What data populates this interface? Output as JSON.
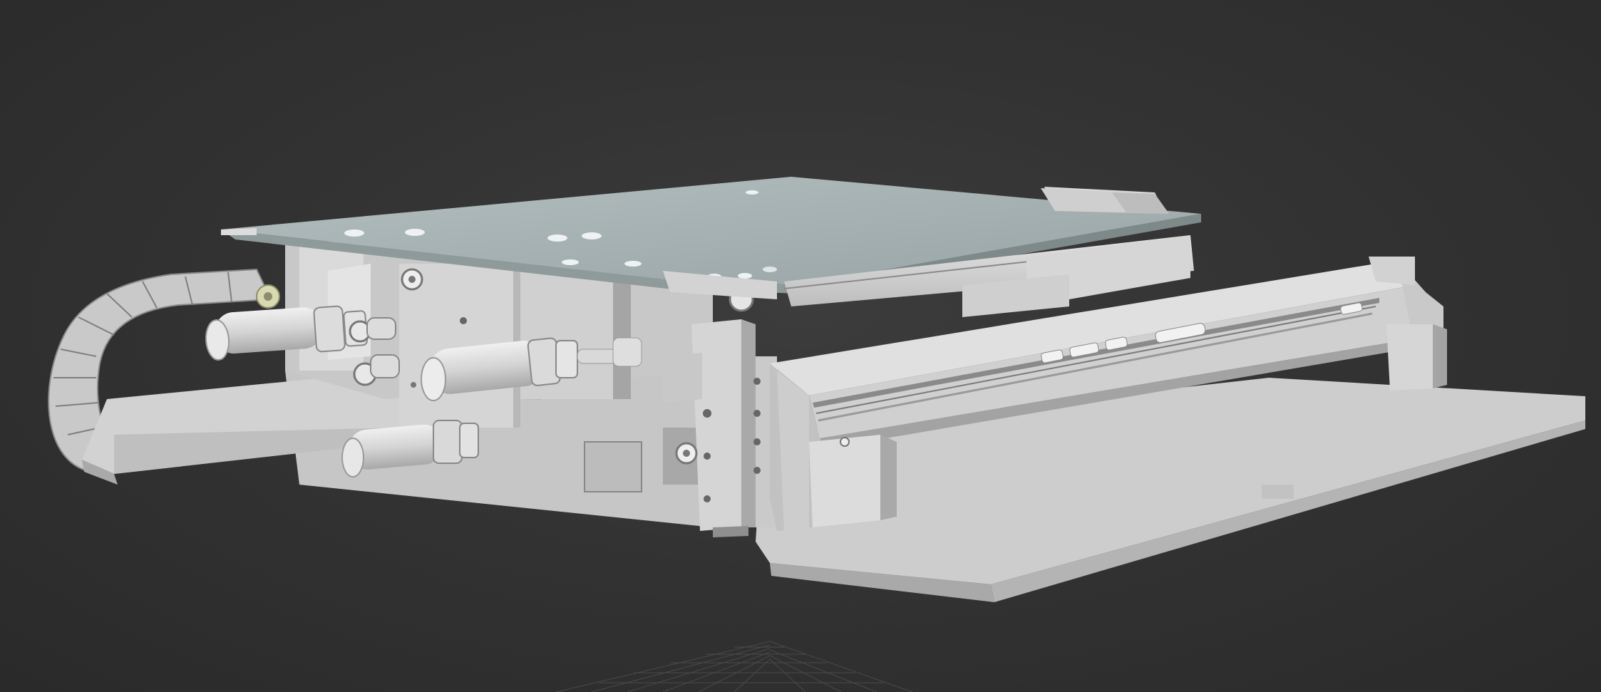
{
  "viewport": {
    "kind": "3d-viewport",
    "shading": "default-shading",
    "background_color": "#333333",
    "grid_color": "#4a4a4a"
  },
  "model": {
    "subject": "linear-stage-assembly",
    "colors": {
      "base_plate": "#cfcfcf",
      "top_plate": "#a7b3b4",
      "parts": "#d8d8d8",
      "shadow": "#9a9a9a",
      "accent_bracket": "#d7d9b0"
    },
    "parts": [
      "base-plate",
      "top-carriage-plate",
      "ball-screw-actuator",
      "cable-drag-chain",
      "pneumatic-cylinder-upper",
      "pneumatic-cylinder-lower",
      "pneumatic-cylinder-center",
      "support-bracket",
      "linear-rail",
      "end-block"
    ]
  }
}
